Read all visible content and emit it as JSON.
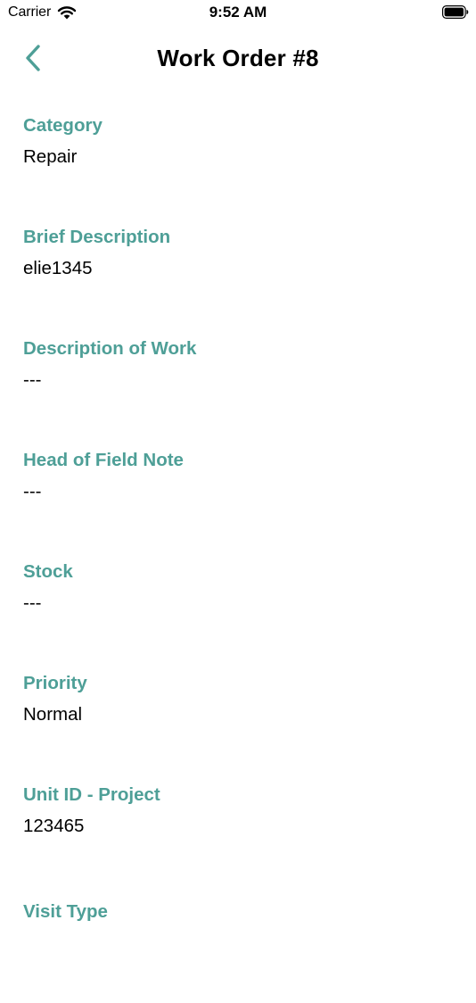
{
  "status_bar": {
    "carrier": "Carrier",
    "time": "9:52 AM",
    "wifi_icon": "wifi-icon",
    "battery_icon": "battery-icon"
  },
  "nav": {
    "title": "Work Order #8",
    "back_icon": "chevron-left-icon"
  },
  "theme": {
    "accent": "#4e9f97"
  },
  "fields": [
    {
      "label": "Category",
      "value": "Repair"
    },
    {
      "label": "Brief Description",
      "value": "elie1345"
    },
    {
      "label": "Description of Work",
      "value": "---"
    },
    {
      "label": "Head of Field Note",
      "value": "---"
    },
    {
      "label": "Stock",
      "value": "---"
    },
    {
      "label": "Priority",
      "value": "Normal"
    },
    {
      "label": "Unit ID - Project",
      "value": "123465"
    },
    {
      "label": "Visit Type"
    }
  ]
}
